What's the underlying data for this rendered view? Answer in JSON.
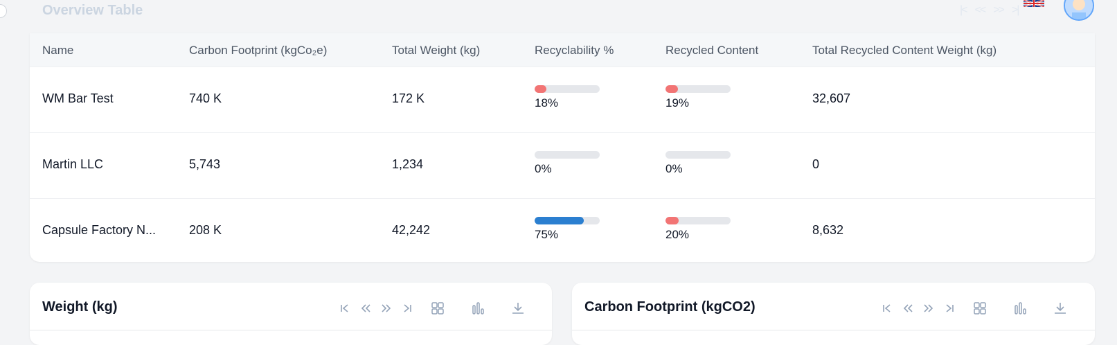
{
  "overview": {
    "title": "Overview Table"
  },
  "header": {
    "flag_icon": "uk-flag-icon",
    "avatar_icon": "user-avatar-icon"
  },
  "table": {
    "headers": [
      "Name",
      "Carbon Footprint (kgCo₂e)",
      "Total Weight (kg)",
      "Recyclability %",
      "Recycled Content",
      "Total Recycled Content Weight (kg)"
    ],
    "rows": [
      {
        "name": "WM Bar Test",
        "carbon": "740 K",
        "weight": "172 K",
        "recyclability": "18%",
        "recyclability_value": 18,
        "recyclability_color": "#f27474",
        "recycled": "19%",
        "recycled_value": 19,
        "recycled_color": "#f27474",
        "total_recycled": "32,607"
      },
      {
        "name": "Martin LLC",
        "carbon": "5,743",
        "weight": "1,234",
        "recyclability": "0%",
        "recyclability_value": 0,
        "recyclability_color": "#f27474",
        "recycled": "0%",
        "recycled_value": 0,
        "recycled_color": "#f27474",
        "total_recycled": "0"
      },
      {
        "name": "Capsule Factory N...",
        "carbon": "208 K",
        "weight": "42,242",
        "recyclability": "75%",
        "recyclability_value": 75,
        "recyclability_color": "#2b7fd0",
        "recycled": "20%",
        "recycled_value": 20,
        "recycled_color": "#f27474",
        "total_recycled": "8,632"
      }
    ]
  },
  "cards": [
    {
      "title": "Weight (kg)"
    },
    {
      "title": "Carbon Footprint (kgCO2)"
    }
  ],
  "icons": {
    "first": "first-page-icon",
    "prev": "previous-page-icon",
    "next": "next-page-icon",
    "last": "last-page-icon",
    "grid": "grid-view-icon",
    "chart": "bar-chart-icon",
    "download": "download-icon"
  },
  "colors": {
    "accent_blue": "#2b7fd0",
    "low_red": "#f27474",
    "bar_track": "#e5e7eb"
  }
}
